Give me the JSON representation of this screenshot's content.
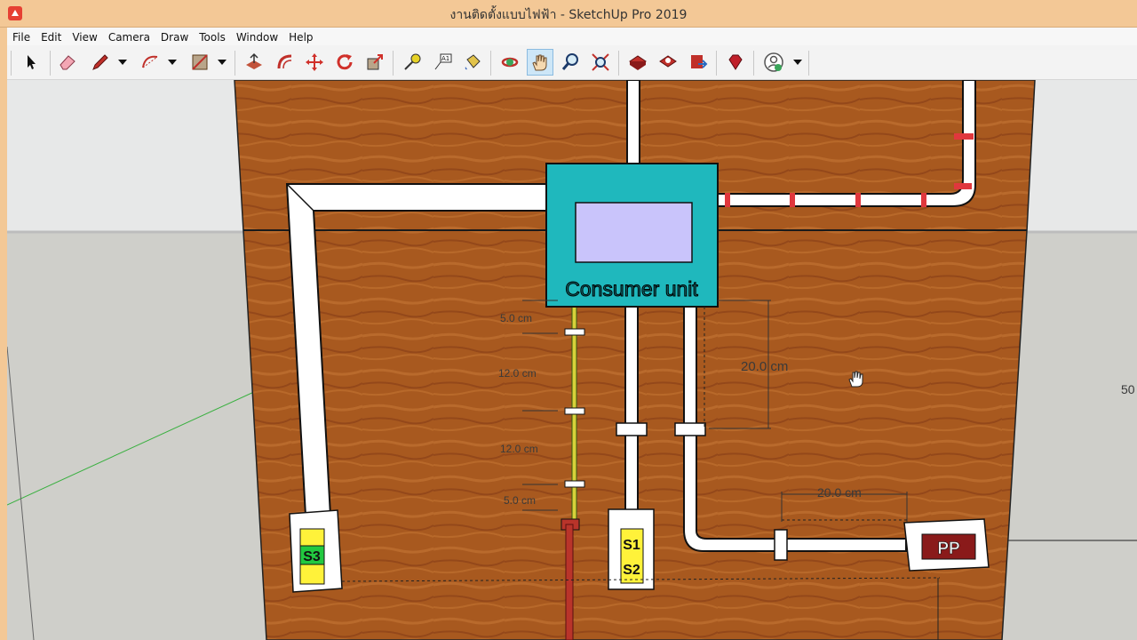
{
  "window": {
    "title": "งานติดตั้งแบบไฟฟ้า - SketchUp Pro 2019"
  },
  "menu": {
    "items": [
      "File",
      "Edit",
      "View",
      "Camera",
      "Draw",
      "Tools",
      "Window",
      "Help"
    ]
  },
  "toolbar": {
    "tools": [
      {
        "name": "select-tool",
        "icon": "arrow-icon"
      },
      {
        "name": "eraser-tool",
        "icon": "eraser-icon"
      },
      {
        "name": "line-tool",
        "icon": "pencil-icon"
      },
      {
        "name": "arc-tool",
        "icon": "arc-icon"
      },
      {
        "name": "rectangle-tool",
        "icon": "rectangle-icon"
      },
      {
        "name": "push-pull-tool",
        "icon": "push-pull-icon"
      },
      {
        "name": "offset-tool",
        "icon": "offset-icon"
      },
      {
        "name": "move-tool",
        "icon": "move-icon"
      },
      {
        "name": "rotate-tool",
        "icon": "rotate-icon"
      },
      {
        "name": "scale-tool",
        "icon": "scale-icon"
      },
      {
        "name": "tape-measure-tool",
        "icon": "tape-icon"
      },
      {
        "name": "text-tool",
        "icon": "text-icon"
      },
      {
        "name": "paint-bucket-tool",
        "icon": "paint-icon"
      },
      {
        "name": "orbit-tool",
        "icon": "orbit-icon"
      },
      {
        "name": "pan-tool",
        "icon": "hand-icon"
      },
      {
        "name": "zoom-tool",
        "icon": "zoom-icon"
      },
      {
        "name": "zoom-extents-tool",
        "icon": "zoom-extents-icon"
      },
      {
        "name": "warehouse-tool",
        "icon": "warehouse-icon"
      },
      {
        "name": "extension-warehouse-tool",
        "icon": "extension-icon"
      },
      {
        "name": "send-to-layout-tool",
        "icon": "layout-icon"
      },
      {
        "name": "ruby-tool",
        "icon": "ruby-icon"
      },
      {
        "name": "account-tool",
        "icon": "account-icon"
      }
    ],
    "active_tool": "pan-tool"
  },
  "scene": {
    "labels": {
      "consumer_unit": "Consumer unit",
      "s3": "S3",
      "s1": "S1",
      "s2": "S2",
      "pp": "PP"
    },
    "dimensions": {
      "d1": "5.0 cm",
      "d2": "12.0 cm",
      "d3": "12.0 cm",
      "d4": "5.0 cm",
      "d5": "20.0 cm",
      "d6": "20.0 cm",
      "edge_partial": "50"
    },
    "colors": {
      "wood": "#a8591f",
      "wood_dark": "#8a4516",
      "consumer_box": "#1fb8bd",
      "panel": "#c9c4fb",
      "conduit": "#ffffff",
      "clip_red": "#e0373d",
      "switch_yellow": "#fff23a",
      "s3_green": "#22c940",
      "ground_wire": "#b9342a",
      "pp_face": "#8a1a1a"
    }
  }
}
